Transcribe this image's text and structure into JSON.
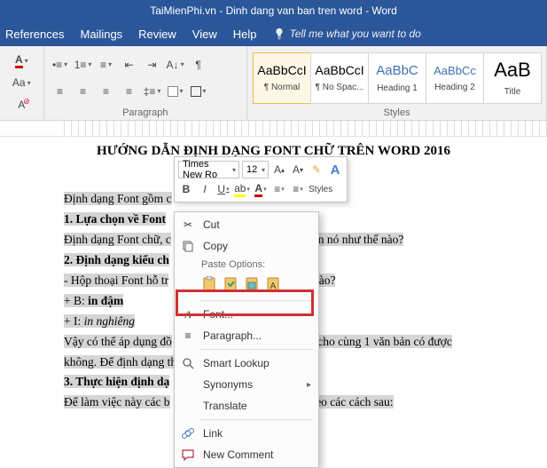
{
  "title": "TaiMienPhi.vn - Dinh dang van ban tren word  -  Word",
  "menu": {
    "references": "References",
    "mailings": "Mailings",
    "review": "Review",
    "view": "View",
    "help": "Help",
    "tellme": "Tell me what you want to do"
  },
  "ribbon": {
    "paragraph": {
      "label": "Paragraph"
    },
    "styles": {
      "label": "Styles",
      "items": [
        {
          "preview": "AaBbCcI",
          "name": "¶ Normal"
        },
        {
          "preview": "AaBbCcI",
          "name": "¶ No Spac..."
        },
        {
          "preview": "AaBbC",
          "name": "Heading 1"
        },
        {
          "preview": "AaBbCc",
          "name": "Heading 2"
        },
        {
          "preview": "AaB",
          "name": "Title"
        }
      ]
    }
  },
  "doc": {
    "heading": "HƯỚNG DẪN ĐỊNH DẠNG FONT CHỮ TRÊN WORD 2016",
    "p1": "Định dạng Font gồm c",
    "p2a": "1. Lựa chọn về Font ",
    "p3a": "Định dạng Font chữ, c",
    "p3b": "c hiện nó như thế nào?",
    "p4": "2. Định dạng kiểu ch",
    "p5a": "- Hộp thoại Font hỗ tr",
    "p5b": "ành nào?",
    "p6a": "+ B: ",
    "p6b": "in đậm",
    "p7a": "+ I: ",
    "p7b": "in nghiêng",
    "p8a": "Vậy có thể áp dụng đồ",
    "p8b": "trên cho cùng 1 văn bản có được không. Để định dạng thì sẽ phải t",
    "p9": "3. Thực hiện định dạ",
    "p10a": "Để làm việc này các b",
    "p10b": "n theo các cách sau:"
  },
  "mini": {
    "font": "Times New Ro",
    "size": "12",
    "stylesLabel": "Styles"
  },
  "ctx": {
    "cut": "Cut",
    "copy": "Copy",
    "pasteHeader": "Paste Options:",
    "font": "Font...",
    "paragraph": "Paragraph...",
    "smart": "Smart Lookup",
    "synonyms": "Synonyms",
    "translate": "Translate",
    "link": "Link",
    "comment": "New Comment"
  }
}
